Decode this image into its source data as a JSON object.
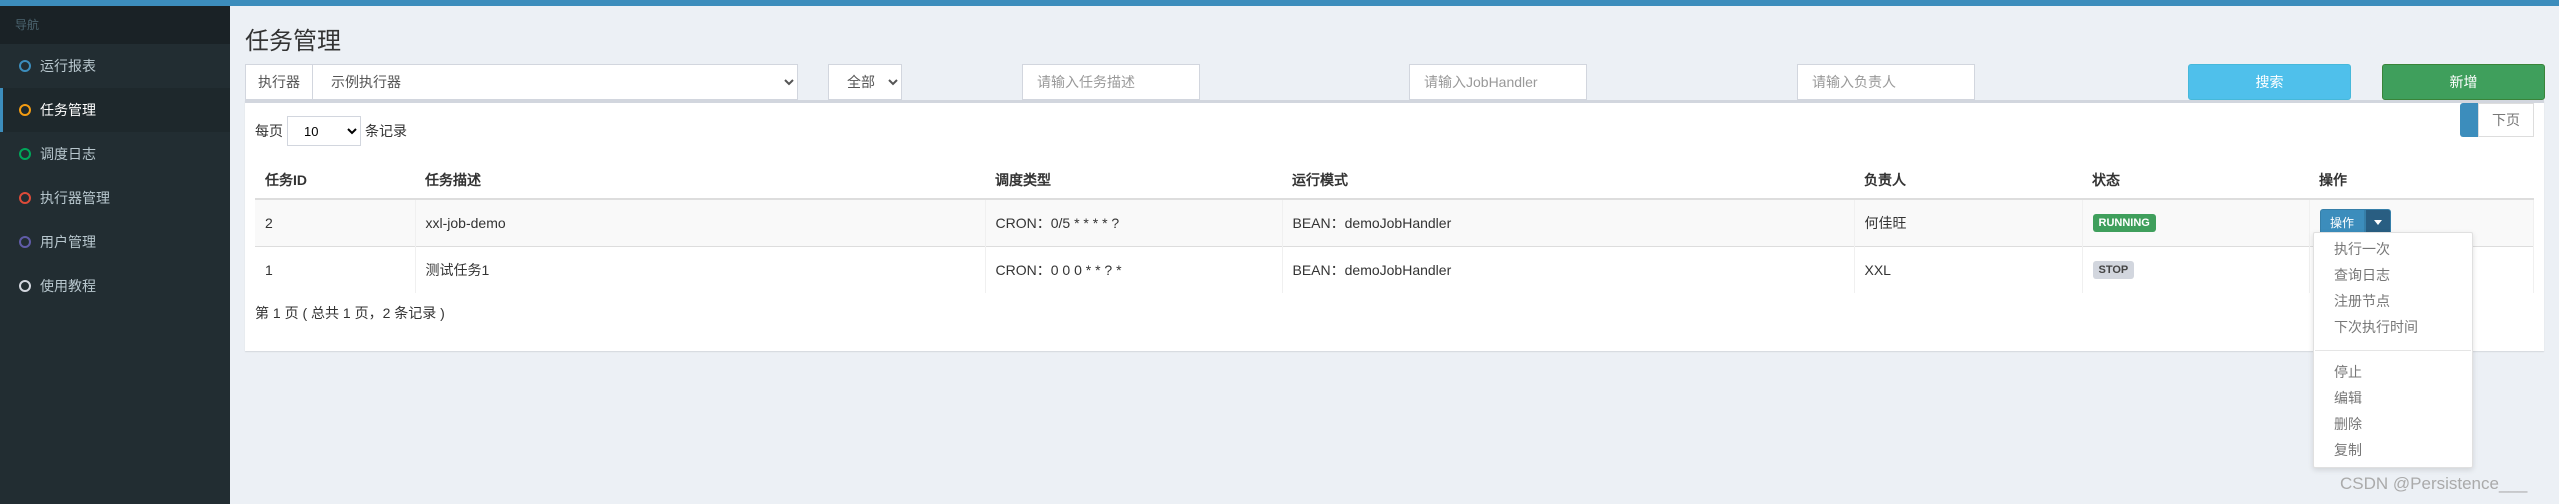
{
  "sidebar": {
    "header": "导航",
    "items": [
      {
        "label": "运行报表",
        "color": "#3c8dbc",
        "active": false
      },
      {
        "label": "任务管理",
        "color": "#f39c12",
        "active": true
      },
      {
        "label": "调度日志",
        "color": "#00a65a",
        "active": false
      },
      {
        "label": "执行器管理",
        "color": "#dd4b39",
        "active": false
      },
      {
        "label": "用户管理",
        "color": "#605ca8",
        "active": false
      },
      {
        "label": "使用教程",
        "color": "#d2d6de",
        "active": false
      }
    ]
  },
  "page": {
    "title": "任务管理"
  },
  "filters": {
    "executor_label": "执行器",
    "executor_value": "示例执行器",
    "status_value": "全部",
    "desc_placeholder": "请输入任务描述",
    "handler_placeholder": "请输入JobHandler",
    "author_placeholder": "请输入负责人",
    "search_label": "搜索",
    "add_label": "新增"
  },
  "length": {
    "prefix": "每页",
    "value": "10",
    "suffix": "条记录"
  },
  "table": {
    "columns": [
      "任务ID",
      "任务描述",
      "调度类型",
      "运行模式",
      "负责人",
      "状态",
      "操作"
    ],
    "rows": [
      {
        "id": "2",
        "desc": "xxl-job-demo",
        "schedule": "CRON：0/5 * * * * ?",
        "mode": "BEAN：demoJobHandler",
        "author": "何佳旺",
        "status": "RUNNING",
        "status_color": "#3f9f5c"
      },
      {
        "id": "1",
        "desc": "测试任务1",
        "schedule": "CRON：0 0 0 * * ? *",
        "mode": "BEAN：demoJobHandler",
        "author": "XXL",
        "status": "STOP",
        "status_color": "#d2d6de"
      }
    ],
    "op_label": "操作"
  },
  "info": "第 1 页 ( 总共 1 页，2 条记录 )",
  "pager": {
    "next": "下页"
  },
  "dropdown": {
    "group1": [
      "执行一次",
      "查询日志",
      "注册节点",
      "下次执行时间"
    ],
    "group2": [
      "停止",
      "编辑",
      "删除",
      "复制"
    ]
  },
  "watermark": "CSDN @Persistence___"
}
